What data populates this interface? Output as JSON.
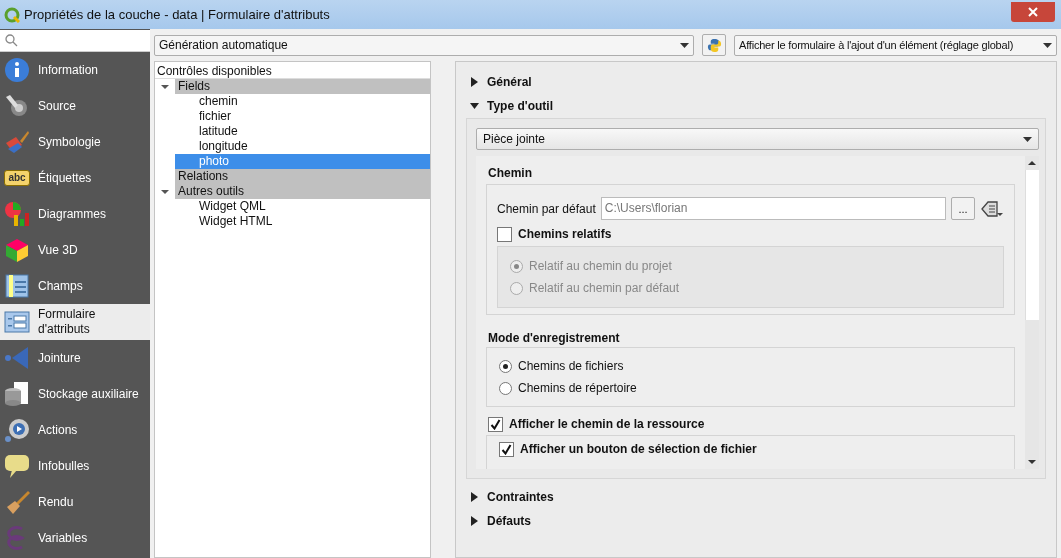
{
  "window": {
    "title": "Propriétés de la couche - data | Formulaire d'attributs"
  },
  "sidebar": {
    "items": [
      {
        "label": "Information",
        "selected": false
      },
      {
        "label": "Source",
        "selected": false
      },
      {
        "label": "Symbologie",
        "selected": false
      },
      {
        "label": "Étiquettes",
        "selected": false,
        "badge": "abc"
      },
      {
        "label": "Diagrammes",
        "selected": false
      },
      {
        "label": "Vue 3D",
        "selected": false
      },
      {
        "label": "Champs",
        "selected": false
      },
      {
        "label": "Formulaire d'attributs",
        "selected": true
      },
      {
        "label": "Jointure",
        "selected": false
      },
      {
        "label": "Stockage auxiliaire",
        "selected": false
      },
      {
        "label": "Actions",
        "selected": false
      },
      {
        "label": "Infobulles",
        "selected": false
      },
      {
        "label": "Rendu",
        "selected": false
      },
      {
        "label": "Variables",
        "selected": false
      }
    ]
  },
  "toolbar": {
    "layout_combo": "Génération automatique",
    "form_combo": "Afficher le formulaire à l'ajout d'un élément (réglage global)"
  },
  "tree": {
    "header": "Contrôles disponibles",
    "items": [
      {
        "label": "Fields",
        "selected": false,
        "expanded": true,
        "children": [
          {
            "label": "chemin",
            "selected": false
          },
          {
            "label": "fichier",
            "selected": false
          },
          {
            "label": "latitude",
            "selected": false
          },
          {
            "label": "longitude",
            "selected": false
          },
          {
            "label": "photo",
            "selected": true
          }
        ]
      },
      {
        "label": "Relations",
        "selected": false
      },
      {
        "label": "Autres outils",
        "selected": false,
        "expanded": true,
        "children": [
          {
            "label": "Widget QML",
            "selected": false
          },
          {
            "label": "Widget HTML",
            "selected": false
          }
        ]
      }
    ]
  },
  "sections": [
    {
      "title": "Général",
      "expanded": false
    },
    {
      "title": "Type d'outil",
      "expanded": true
    },
    {
      "title": "Contraintes",
      "expanded": false
    },
    {
      "title": "Défauts",
      "expanded": false
    }
  ],
  "widget_type": {
    "value": "Pièce jointe",
    "path": {
      "title": "Chemin",
      "default_label": "Chemin par défaut",
      "default_value": "C:\\Users\\florian",
      "browse": "...",
      "relative": {
        "label": "Chemins relatifs",
        "checked": false,
        "options": [
          {
            "label": "Relatif au chemin du projet",
            "selected": true,
            "disabled": true
          },
          {
            "label": "Relatif au chemin par défaut",
            "selected": false,
            "disabled": true
          }
        ]
      }
    },
    "storage": {
      "title": "Mode d'enregistrement",
      "options": [
        {
          "label": "Chemins de fichiers",
          "selected": true,
          "disabled": false
        },
        {
          "label": "Chemins de répertoire",
          "selected": false,
          "disabled": false
        }
      ]
    },
    "show_path": {
      "label": "Afficher le chemin de la ressource",
      "checked": true
    },
    "show_button": {
      "label": "Afficher un bouton de sélection de fichier",
      "checked": true
    }
  }
}
